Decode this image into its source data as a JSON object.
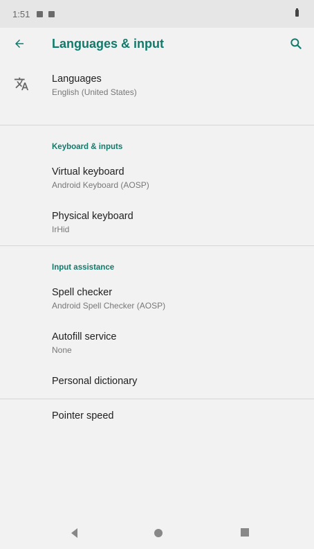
{
  "status_bar": {
    "time": "1:51"
  },
  "app_bar": {
    "title": "Languages & input"
  },
  "languages": {
    "title": "Languages",
    "summary": "English (United States)"
  },
  "sections": {
    "keyboard": {
      "header": "Keyboard & inputs"
    },
    "assistance": {
      "header": "Input assistance"
    }
  },
  "items": {
    "virtual_keyboard": {
      "title": "Virtual keyboard",
      "summary": "Android Keyboard (AOSP)"
    },
    "physical_keyboard": {
      "title": "Physical keyboard",
      "summary": "IrHid"
    },
    "spell_checker": {
      "title": "Spell checker",
      "summary": "Android Spell Checker (AOSP)"
    },
    "autofill_service": {
      "title": "Autofill service",
      "summary": "None"
    },
    "personal_dictionary": {
      "title": "Personal dictionary"
    },
    "pointer_speed": {
      "title": "Pointer speed"
    }
  },
  "colors": {
    "accent": "#117a6b",
    "background": "#f2f2f2",
    "status_bar": "#e6e6e6"
  },
  "icons": [
    "arrow-back-icon",
    "search-icon",
    "translate-icon",
    "nav-back-icon",
    "nav-home-icon",
    "nav-recents-icon"
  ]
}
